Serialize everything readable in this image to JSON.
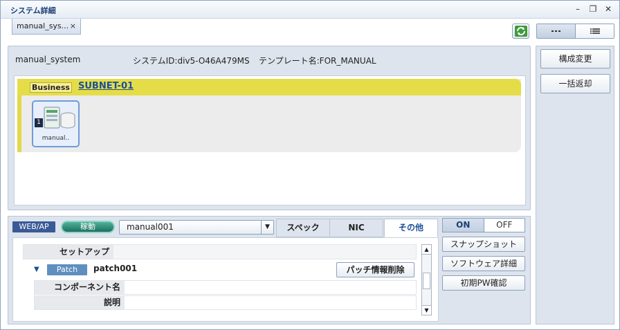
{
  "window": {
    "title": "システム詳細"
  },
  "tabs": [
    {
      "label": "manual_sys...",
      "close": "×"
    }
  ],
  "system": {
    "name": "manual_system",
    "id_text": "システムID:div5-O46A479MS",
    "template_text": "テンプレート名:FOR_MANUAL"
  },
  "subnet": {
    "badge": "Business",
    "name": "SUBNET-01",
    "server": {
      "number": "1",
      "label": "manual.."
    }
  },
  "side_actions": {
    "config_change": "構成変更",
    "bulk_return": "一括返却"
  },
  "detail": {
    "role_badge": "WEB/AP",
    "status": "稼動",
    "selected_vm": "manual001",
    "tabs": [
      "スペック",
      "NIC",
      "その他"
    ],
    "active_tab": "その他",
    "setup_label": "セットアップ",
    "patch_badge": "Patch",
    "patch_name": "patch001",
    "delete_patch": "パッチ情報削除",
    "component_label": "コンポーネント名",
    "description_label": "説明"
  },
  "power": {
    "on": "ON",
    "off": "OFF"
  },
  "actions": {
    "snapshot": "スナップショット",
    "software_detail": "ソフトウェア詳細",
    "initial_pw": "初期PW確認"
  },
  "colors": {
    "accent": "#1a4f9a",
    "subnet_yellow": "#e5dd48",
    "status_green": "#1e6f5f"
  },
  "icons": {
    "refresh": "refresh-icon",
    "server": "server-icon",
    "list_view": "list-view-icon",
    "dots_view": "dots-view-icon"
  }
}
